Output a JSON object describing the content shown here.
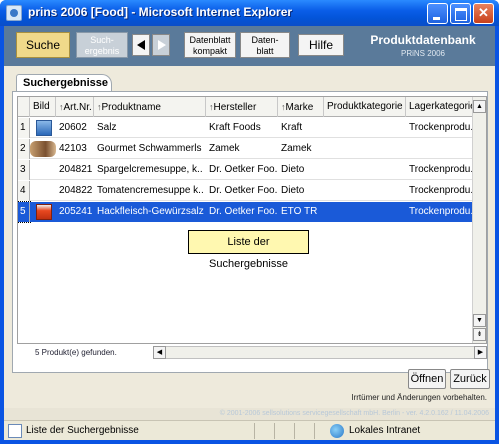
{
  "window": {
    "title": "prins 2006 [Food] - Microsoft Internet Explorer"
  },
  "header": {
    "suche_label": "Suche",
    "sucherg_label": "Such-\nergebnis",
    "datenblatt_kompakt_label": "Datenblatt\nkompakt",
    "datenblatt_label": "Daten-\nblatt",
    "hilfe_label": "Hilfe",
    "brand_title": "Produktdatenbank",
    "brand_sub": "PRiNS 2006"
  },
  "tab": {
    "label": "Suchergebnisse"
  },
  "table": {
    "columns": [
      "Bild",
      "Art.Nr.",
      "Produktname",
      "Hersteller",
      "Marke",
      "Produktkategorie",
      "Lagerkategorie"
    ],
    "rows": [
      {
        "num": "1",
        "artnr": "20602",
        "name": "Salz",
        "hersteller": "Kraft Foods",
        "marke": "Kraft",
        "kategorie": "",
        "lager": "Trockenprodu..."
      },
      {
        "num": "2",
        "artnr": "42103",
        "name": "Gourmet Schwammerls",
        "hersteller": "Zamek",
        "marke": "Zamek",
        "kategorie": "",
        "lager": ""
      },
      {
        "num": "3",
        "artnr": "204821",
        "name": "Spargelcremesuppe, k..",
        "hersteller": "Dr. Oetker Foo..",
        "marke": "Dieto",
        "kategorie": "",
        "lager": "Trockenprodu..."
      },
      {
        "num": "4",
        "artnr": "204822",
        "name": "Tomatencremesuppe k..",
        "hersteller": "Dr. Oetker Foo..",
        "marke": "Dieto",
        "kategorie": "",
        "lager": "Trockenprodu..."
      },
      {
        "num": "5",
        "artnr": "205241",
        "name": "Hackfleisch-Gewürzsalz",
        "hersteller": "Dr. Oetker Foo..",
        "marke": "ETO TR",
        "kategorie": "",
        "lager": "Trockenprodu..."
      }
    ]
  },
  "tooltip": {
    "text": "Liste der Suchergebnisse"
  },
  "footer": {
    "count_text": "5  Produkt(e) gefunden.",
    "oeffnen_label": "Öffnen",
    "zurueck_label": "Zurück",
    "note": "Irrtümer und Änderungen vorbehalten.",
    "copyright": "© 2001-2006 sellsolutions servicegesellschaft mbH. Berlin - ver. 4.2.0.162 / 11.04.2006"
  },
  "statusbar": {
    "left_text": "Liste der Suchergebnisse",
    "zone_text": "Lokales Intranet"
  }
}
